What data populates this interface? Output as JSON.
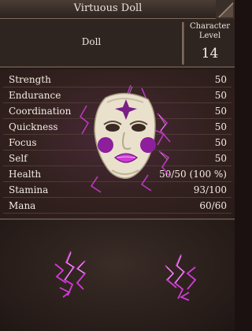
{
  "window": {
    "title": "Virtuous Doll"
  },
  "header": {
    "class_name": "Doll",
    "level_label_line1": "Character",
    "level_label_line2": "Level",
    "level_value": "14"
  },
  "stats": [
    {
      "label": "Strength",
      "value": "50"
    },
    {
      "label": "Endurance",
      "value": "50"
    },
    {
      "label": "Coordination",
      "value": "50"
    },
    {
      "label": "Quickness",
      "value": "50"
    },
    {
      "label": "Focus",
      "value": "50"
    },
    {
      "label": "Self",
      "value": "50"
    },
    {
      "label": "Health",
      "value": "50/50 (100 %)"
    },
    {
      "label": "Stamina",
      "value": "93/100"
    },
    {
      "label": "Mana",
      "value": "60/60"
    }
  ],
  "colors": {
    "accent_magenta": "#d23bd8",
    "text": "#f3ece1"
  },
  "icons": {
    "portrait": "doll-mask-portrait",
    "effects": "magenta-lightning-spark"
  }
}
